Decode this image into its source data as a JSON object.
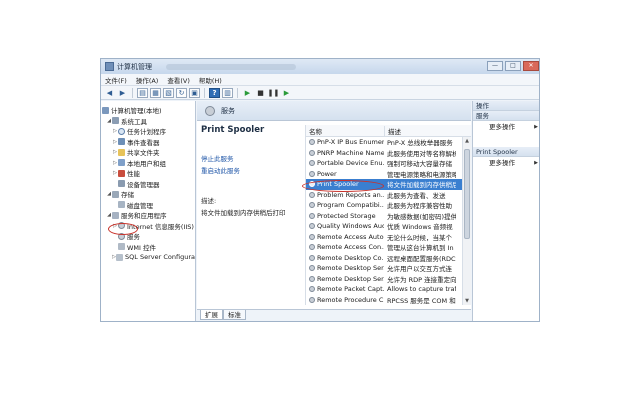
{
  "window": {
    "title": "计算机管理",
    "buttons": {
      "minimize": "—",
      "maximize": "□",
      "close": "✕"
    }
  },
  "menu": [
    "文件(F)",
    "操作(A)",
    "查看(V)",
    "帮助(H)"
  ],
  "tree": {
    "root": "计算机管理(本地)",
    "items": [
      {
        "label": "系统工具",
        "level": 1,
        "expanded": true,
        "icon": "tools-icon"
      },
      {
        "label": "任务计划程序",
        "level": 2,
        "icon": "clock-icon"
      },
      {
        "label": "事件查看器",
        "level": 2,
        "icon": "event-viewer-icon"
      },
      {
        "label": "共享文件夹",
        "level": 2,
        "icon": "folder-icon"
      },
      {
        "label": "本地用户和组",
        "level": 2,
        "icon": "users-icon"
      },
      {
        "label": "性能",
        "level": 2,
        "icon": "performance-icon"
      },
      {
        "label": "设备管理器",
        "level": 2,
        "icon": "device-manager-icon"
      },
      {
        "label": "存储",
        "level": 1,
        "expanded": true,
        "icon": "storage-icon"
      },
      {
        "label": "磁盘管理",
        "level": 2,
        "icon": "disk-icon"
      },
      {
        "label": "服务和应用程序",
        "level": 1,
        "expanded": true,
        "icon": "services-apps-icon"
      },
      {
        "label": "Internet 信息服务(IIS)",
        "level": 2,
        "icon": "service-icon"
      },
      {
        "label": "服务",
        "level": 2,
        "icon": "service-icon"
      },
      {
        "label": "WMI 控件",
        "level": 2,
        "icon": "wmi-icon"
      },
      {
        "label": "SQL Server Configura",
        "level": 2,
        "icon": "sql-icon"
      }
    ]
  },
  "center": {
    "header": "服务",
    "selected_service": "Print Spooler",
    "stop_link": "停止此服务",
    "restart_link": "重启动此服务",
    "desc_label": "描述:",
    "desc_text": "将文件加载到内存供稍后打印"
  },
  "list": {
    "columns": [
      "名称",
      "描述"
    ],
    "rows": [
      {
        "name": "PnP-X IP Bus Enumer...",
        "desc": "PnP-X 总线枚举器服务",
        "selected": false
      },
      {
        "name": "PNRP Machine Name...",
        "desc": "此服务使用对等名称解析",
        "selected": false
      },
      {
        "name": "Portable Device Enu...",
        "desc": "强制可移动大容量存储",
        "selected": false
      },
      {
        "name": "Power",
        "desc": "管理电源策略和电源策略",
        "selected": false
      },
      {
        "name": "Print Spooler",
        "desc": "将文件加载到内存供稍后",
        "selected": true
      },
      {
        "name": "Problem Reports an...",
        "desc": "此服务为查看、发送",
        "selected": false
      },
      {
        "name": "Program Compatibi...",
        "desc": "此服务为程序兼容性助",
        "selected": false
      },
      {
        "name": "Protected Storage",
        "desc": "为敏感数据(如密码)提供",
        "selected": false
      },
      {
        "name": "Quality Windows Aud...",
        "desc": "优质 Windows 音频视",
        "selected": false
      },
      {
        "name": "Remote Access Auto ...",
        "desc": "无论什么时候，当某个",
        "selected": false
      },
      {
        "name": "Remote Access Con...",
        "desc": "管理从这台计算机到 In",
        "selected": false
      },
      {
        "name": "Remote Desktop Co...",
        "desc": "远程桌面配置服务(RDC",
        "selected": false
      },
      {
        "name": "Remote Desktop Ser...",
        "desc": "允许用户以交互方式连",
        "selected": false
      },
      {
        "name": "Remote Desktop Ser...",
        "desc": "允许为 RDP 连接重定向",
        "selected": false
      },
      {
        "name": "Remote Packet Capt...",
        "desc": "Allows to capture traff",
        "selected": false
      },
      {
        "name": "Remote Procedure C...",
        "desc": "RPCSS 服务是 COM 和",
        "selected": false
      }
    ]
  },
  "tabs": [
    {
      "label": "扩展",
      "active": true
    },
    {
      "label": "标准",
      "active": false
    }
  ],
  "actions": {
    "header": "操作",
    "group1": "服务",
    "more1": "更多操作",
    "group2": "Print Spooler",
    "more2": "更多操作"
  },
  "colors": {
    "selection": "#3a7fd0",
    "annotation": "#c8322a",
    "link": "#1f56a8"
  }
}
